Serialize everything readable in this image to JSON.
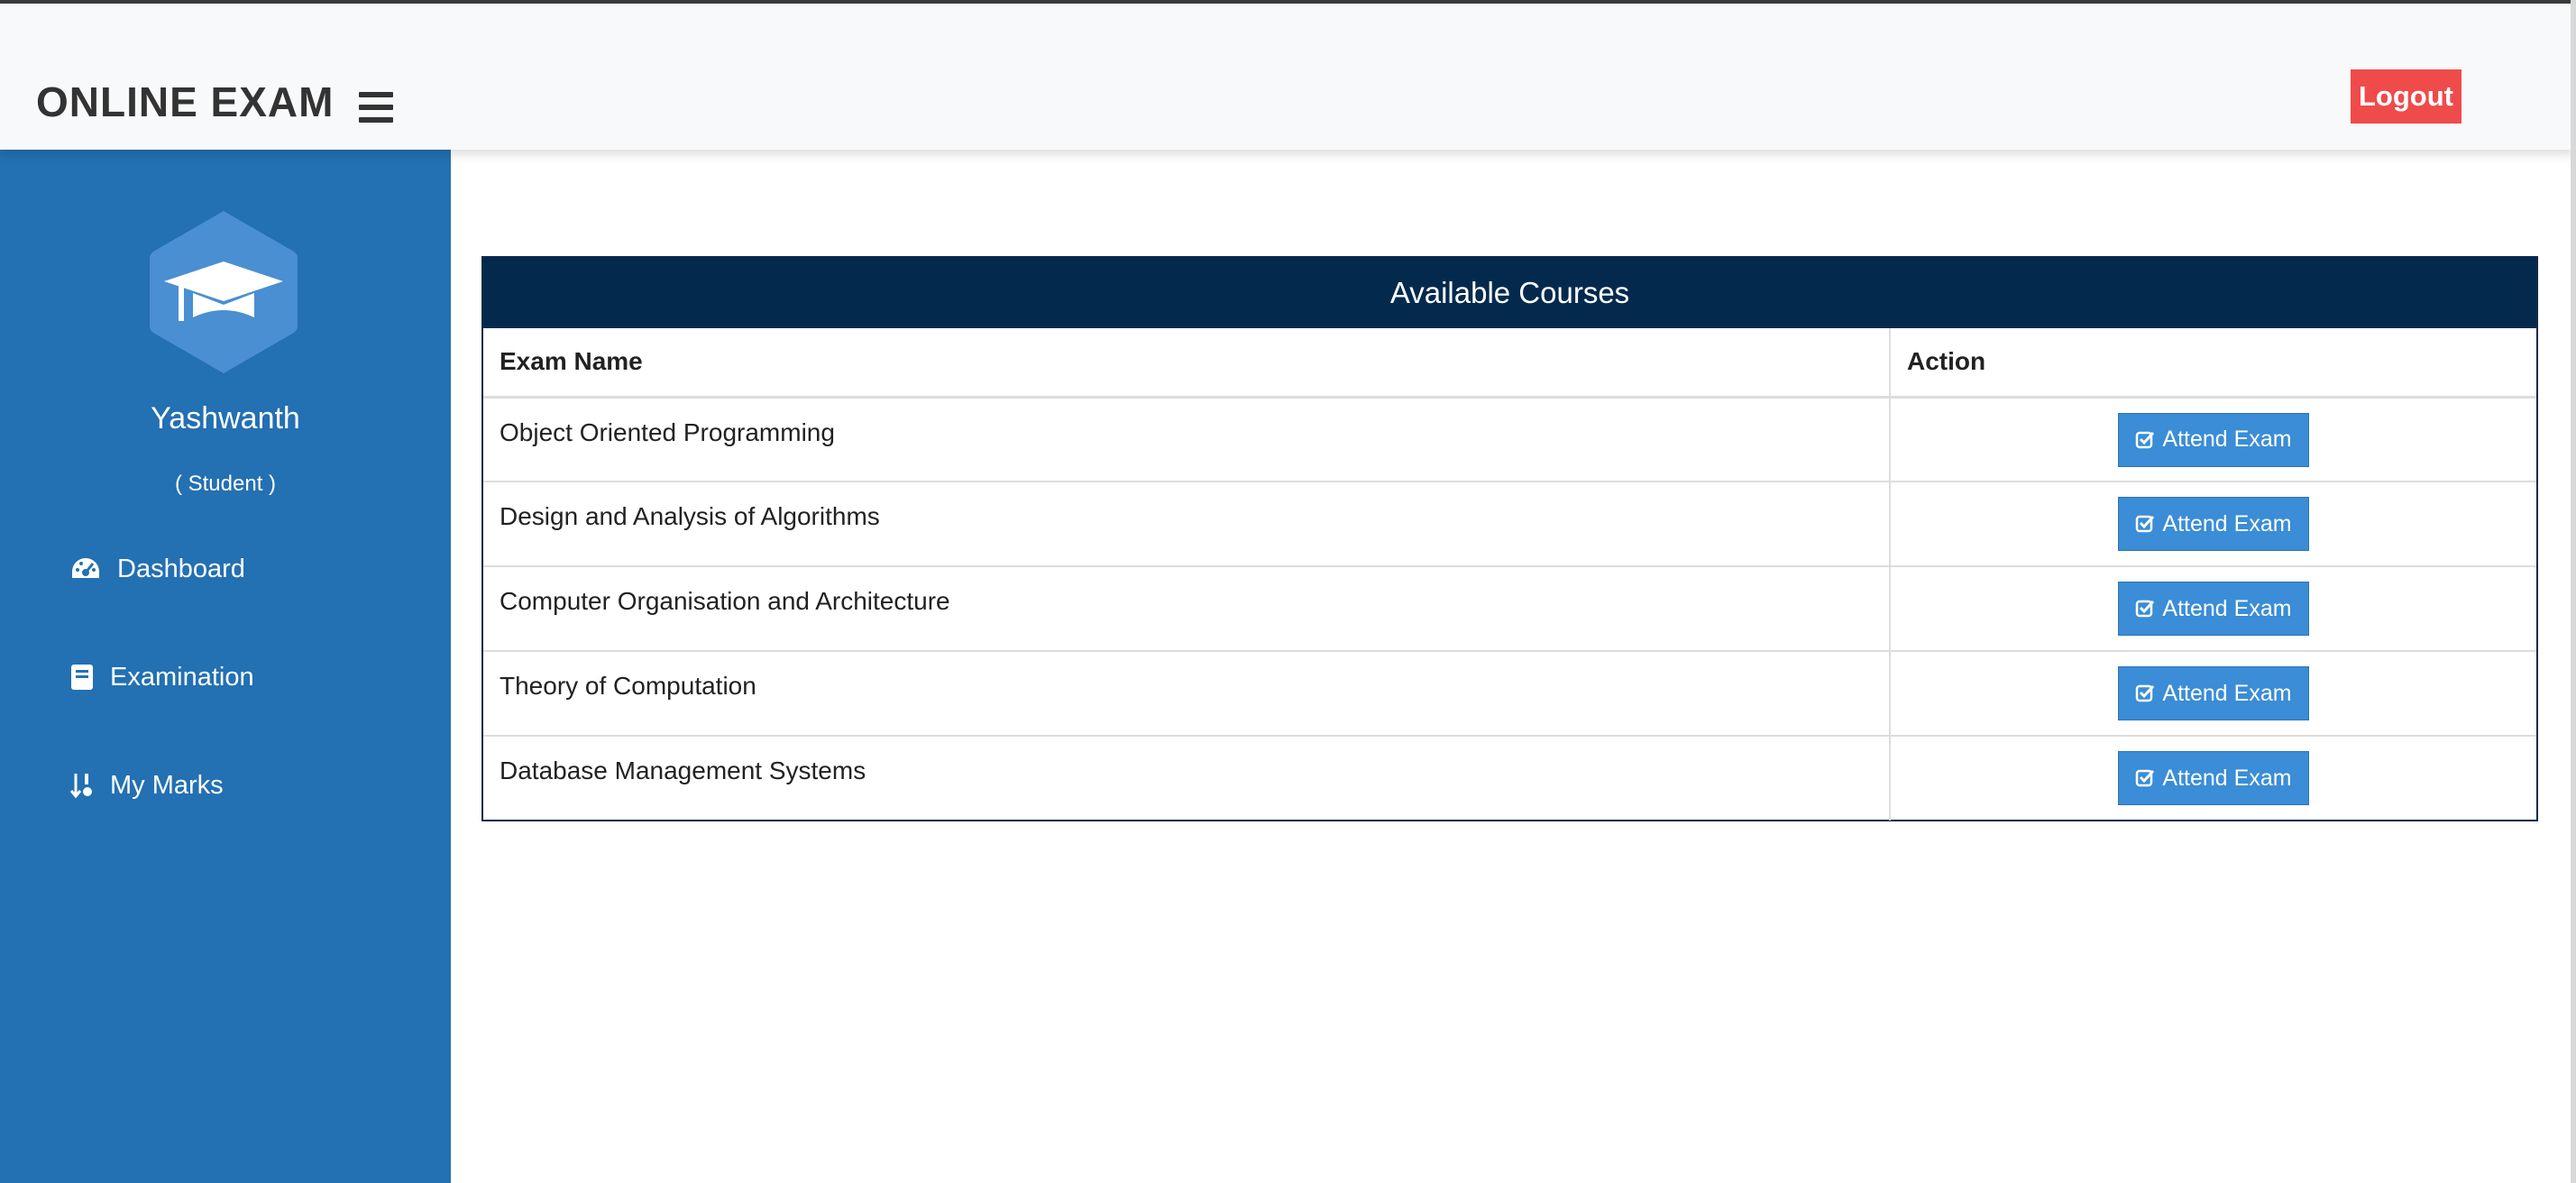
{
  "header": {
    "brand": "ONLINE EXAM",
    "logout_label": "Logout"
  },
  "sidebar": {
    "username": "Yashwanth",
    "role": "( Student )",
    "items": [
      {
        "label": "Dashboard",
        "icon": "dashboard-gauge-icon"
      },
      {
        "label": "Examination",
        "icon": "book-icon"
      },
      {
        "label": "My Marks",
        "icon": "sort-numeric-icon"
      }
    ]
  },
  "courses": {
    "title": "Available Courses",
    "columns": [
      "Exam Name",
      "Action"
    ],
    "rows": [
      {
        "name": "Object Oriented Programming",
        "action": "Attend Exam"
      },
      {
        "name": "Design and Analysis of Algorithms",
        "action": "Attend Exam"
      },
      {
        "name": "Computer Organisation and Architecture",
        "action": "Attend Exam"
      },
      {
        "name": "Theory of Computation",
        "action": "Attend Exam"
      },
      {
        "name": "Database Management Systems",
        "action": "Attend Exam"
      }
    ]
  },
  "colors": {
    "sidebar": "#2370b2",
    "table_header": "#032a4d",
    "logout": "#ef4b4b",
    "attend_button": "#3a8dd6"
  }
}
